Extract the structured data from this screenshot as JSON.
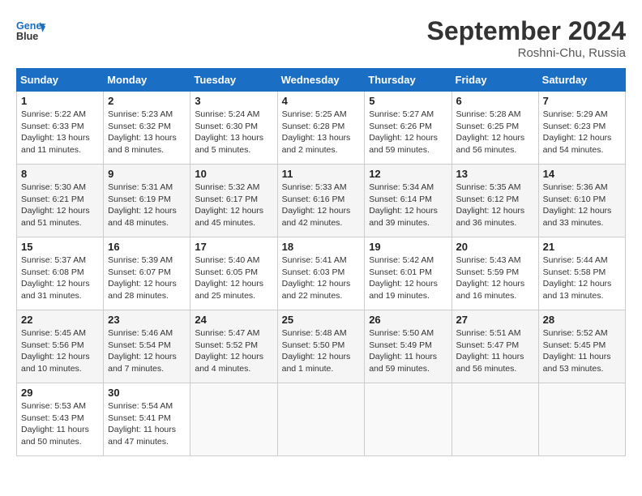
{
  "header": {
    "logo_line1": "General",
    "logo_line2": "Blue",
    "month_title": "September 2024",
    "location": "Roshni-Chu, Russia"
  },
  "weekdays": [
    "Sunday",
    "Monday",
    "Tuesday",
    "Wednesday",
    "Thursday",
    "Friday",
    "Saturday"
  ],
  "weeks": [
    [
      {
        "day": "1",
        "sunrise": "Sunrise: 5:22 AM",
        "sunset": "Sunset: 6:33 PM",
        "daylight": "Daylight: 13 hours and 11 minutes."
      },
      {
        "day": "2",
        "sunrise": "Sunrise: 5:23 AM",
        "sunset": "Sunset: 6:32 PM",
        "daylight": "Daylight: 13 hours and 8 minutes."
      },
      {
        "day": "3",
        "sunrise": "Sunrise: 5:24 AM",
        "sunset": "Sunset: 6:30 PM",
        "daylight": "Daylight: 13 hours and 5 minutes."
      },
      {
        "day": "4",
        "sunrise": "Sunrise: 5:25 AM",
        "sunset": "Sunset: 6:28 PM",
        "daylight": "Daylight: 13 hours and 2 minutes."
      },
      {
        "day": "5",
        "sunrise": "Sunrise: 5:27 AM",
        "sunset": "Sunset: 6:26 PM",
        "daylight": "Daylight: 12 hours and 59 minutes."
      },
      {
        "day": "6",
        "sunrise": "Sunrise: 5:28 AM",
        "sunset": "Sunset: 6:25 PM",
        "daylight": "Daylight: 12 hours and 56 minutes."
      },
      {
        "day": "7",
        "sunrise": "Sunrise: 5:29 AM",
        "sunset": "Sunset: 6:23 PM",
        "daylight": "Daylight: 12 hours and 54 minutes."
      }
    ],
    [
      {
        "day": "8",
        "sunrise": "Sunrise: 5:30 AM",
        "sunset": "Sunset: 6:21 PM",
        "daylight": "Daylight: 12 hours and 51 minutes."
      },
      {
        "day": "9",
        "sunrise": "Sunrise: 5:31 AM",
        "sunset": "Sunset: 6:19 PM",
        "daylight": "Daylight: 12 hours and 48 minutes."
      },
      {
        "day": "10",
        "sunrise": "Sunrise: 5:32 AM",
        "sunset": "Sunset: 6:17 PM",
        "daylight": "Daylight: 12 hours and 45 minutes."
      },
      {
        "day": "11",
        "sunrise": "Sunrise: 5:33 AM",
        "sunset": "Sunset: 6:16 PM",
        "daylight": "Daylight: 12 hours and 42 minutes."
      },
      {
        "day": "12",
        "sunrise": "Sunrise: 5:34 AM",
        "sunset": "Sunset: 6:14 PM",
        "daylight": "Daylight: 12 hours and 39 minutes."
      },
      {
        "day": "13",
        "sunrise": "Sunrise: 5:35 AM",
        "sunset": "Sunset: 6:12 PM",
        "daylight": "Daylight: 12 hours and 36 minutes."
      },
      {
        "day": "14",
        "sunrise": "Sunrise: 5:36 AM",
        "sunset": "Sunset: 6:10 PM",
        "daylight": "Daylight: 12 hours and 33 minutes."
      }
    ],
    [
      {
        "day": "15",
        "sunrise": "Sunrise: 5:37 AM",
        "sunset": "Sunset: 6:08 PM",
        "daylight": "Daylight: 12 hours and 31 minutes."
      },
      {
        "day": "16",
        "sunrise": "Sunrise: 5:39 AM",
        "sunset": "Sunset: 6:07 PM",
        "daylight": "Daylight: 12 hours and 28 minutes."
      },
      {
        "day": "17",
        "sunrise": "Sunrise: 5:40 AM",
        "sunset": "Sunset: 6:05 PM",
        "daylight": "Daylight: 12 hours and 25 minutes."
      },
      {
        "day": "18",
        "sunrise": "Sunrise: 5:41 AM",
        "sunset": "Sunset: 6:03 PM",
        "daylight": "Daylight: 12 hours and 22 minutes."
      },
      {
        "day": "19",
        "sunrise": "Sunrise: 5:42 AM",
        "sunset": "Sunset: 6:01 PM",
        "daylight": "Daylight: 12 hours and 19 minutes."
      },
      {
        "day": "20",
        "sunrise": "Sunrise: 5:43 AM",
        "sunset": "Sunset: 5:59 PM",
        "daylight": "Daylight: 12 hours and 16 minutes."
      },
      {
        "day": "21",
        "sunrise": "Sunrise: 5:44 AM",
        "sunset": "Sunset: 5:58 PM",
        "daylight": "Daylight: 12 hours and 13 minutes."
      }
    ],
    [
      {
        "day": "22",
        "sunrise": "Sunrise: 5:45 AM",
        "sunset": "Sunset: 5:56 PM",
        "daylight": "Daylight: 12 hours and 10 minutes."
      },
      {
        "day": "23",
        "sunrise": "Sunrise: 5:46 AM",
        "sunset": "Sunset: 5:54 PM",
        "daylight": "Daylight: 12 hours and 7 minutes."
      },
      {
        "day": "24",
        "sunrise": "Sunrise: 5:47 AM",
        "sunset": "Sunset: 5:52 PM",
        "daylight": "Daylight: 12 hours and 4 minutes."
      },
      {
        "day": "25",
        "sunrise": "Sunrise: 5:48 AM",
        "sunset": "Sunset: 5:50 PM",
        "daylight": "Daylight: 12 hours and 1 minute."
      },
      {
        "day": "26",
        "sunrise": "Sunrise: 5:50 AM",
        "sunset": "Sunset: 5:49 PM",
        "daylight": "Daylight: 11 hours and 59 minutes."
      },
      {
        "day": "27",
        "sunrise": "Sunrise: 5:51 AM",
        "sunset": "Sunset: 5:47 PM",
        "daylight": "Daylight: 11 hours and 56 minutes."
      },
      {
        "day": "28",
        "sunrise": "Sunrise: 5:52 AM",
        "sunset": "Sunset: 5:45 PM",
        "daylight": "Daylight: 11 hours and 53 minutes."
      }
    ],
    [
      {
        "day": "29",
        "sunrise": "Sunrise: 5:53 AM",
        "sunset": "Sunset: 5:43 PM",
        "daylight": "Daylight: 11 hours and 50 minutes."
      },
      {
        "day": "30",
        "sunrise": "Sunrise: 5:54 AM",
        "sunset": "Sunset: 5:41 PM",
        "daylight": "Daylight: 11 hours and 47 minutes."
      },
      null,
      null,
      null,
      null,
      null
    ]
  ]
}
